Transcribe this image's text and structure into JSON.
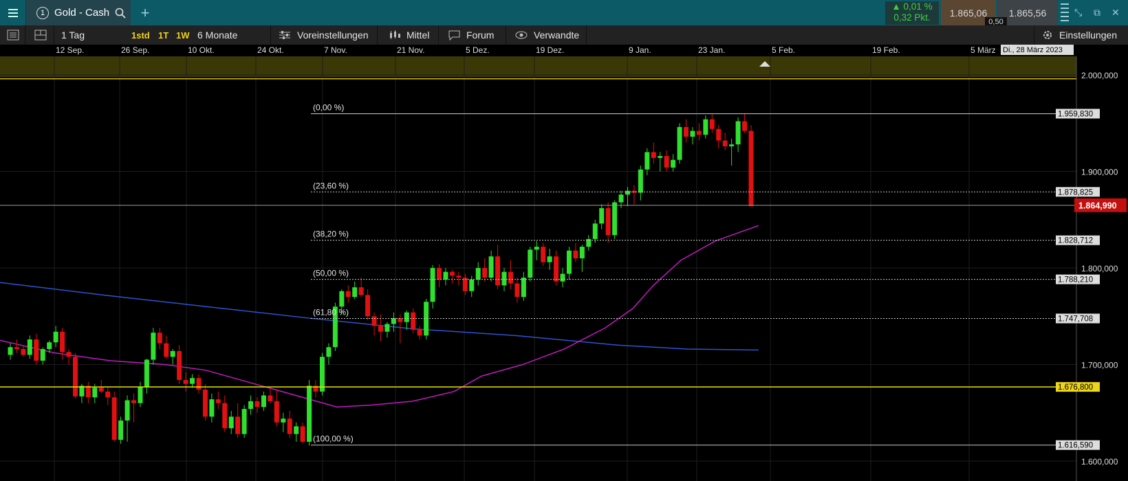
{
  "header": {
    "instrument_number": "1",
    "instrument_name": "Gold - Cash",
    "add_tab": "+",
    "change_percent": "0,01 %",
    "change_points": "0,32 Pkt.",
    "bid": "1.865,06",
    "ask": "1.865,56",
    "spread": "0,50",
    "change_color": "#3fd03f"
  },
  "toolbar": {
    "interval": "1 Tag",
    "quick1": "1std",
    "quick2": "1T",
    "quick3": "1W",
    "period": "6 Monate",
    "presets": "Voreinstellungen",
    "indicators": "Mittel",
    "forum": "Forum",
    "related": "Verwandte",
    "settings": "Einstellungen"
  },
  "chart_data": {
    "type": "candlestick",
    "x_axis_labels": [
      "12 Sep.",
      "26 Sep.",
      "10 Okt.",
      "24 Okt.",
      "7 Nov.",
      "21 Nov.",
      "5 Dez.",
      "19 Dez.",
      "9 Jan.",
      "23 Jan.",
      "5 Feb.",
      "19 Feb.",
      "5 März"
    ],
    "crosshair_date": "Di., 28 März 2023",
    "y_axis_labels": [
      "2.000,000",
      "1.900,000",
      "1.800,000",
      "1.700,000",
      "1.600,000"
    ],
    "ylim": [
      1582,
      2052
    ],
    "current_price": "1.864,990",
    "current_price_value": 1864.99,
    "fibonacci": [
      {
        "label": "(0,00 %)",
        "value": 1959.83,
        "tag": "1.959,830"
      },
      {
        "label": "(23,60 %)",
        "value": 1878.825,
        "tag": "1.878,825"
      },
      {
        "label": "(38,20 %)",
        "value": 1828.712,
        "tag": "1.828,712"
      },
      {
        "label": "(50,00 %)",
        "value": 1788.21,
        "tag": "1.788,210"
      },
      {
        "label": "(61,80 %)",
        "value": 1747.708,
        "tag": "1.747,708"
      },
      {
        "label": "(100,00 %)",
        "value": 1616.59,
        "tag": "1.616,590"
      }
    ],
    "horizontal_line": {
      "value": 1676.8,
      "tag": "1.676,800",
      "color": "#e6e600"
    },
    "upper_line": {
      "value": 1996,
      "color": "#e6c400"
    },
    "candles": [
      [
        1710,
        1722,
        1705,
        1718
      ],
      [
        1718,
        1726,
        1712,
        1716
      ],
      [
        1716,
        1720,
        1708,
        1710
      ],
      [
        1710,
        1730,
        1706,
        1726
      ],
      [
        1726,
        1732,
        1700,
        1704
      ],
      [
        1704,
        1718,
        1700,
        1716
      ],
      [
        1716,
        1725,
        1712,
        1723
      ],
      [
        1723,
        1740,
        1718,
        1734
      ],
      [
        1734,
        1738,
        1705,
        1713
      ],
      [
        1713,
        1716,
        1700,
        1708
      ],
      [
        1708,
        1712,
        1665,
        1667
      ],
      [
        1667,
        1680,
        1660,
        1678
      ],
      [
        1678,
        1682,
        1660,
        1666
      ],
      [
        1666,
        1680,
        1660,
        1676
      ],
      [
        1676,
        1684,
        1670,
        1672
      ],
      [
        1672,
        1676,
        1658,
        1666
      ],
      [
        1666,
        1672,
        1620,
        1622
      ],
      [
        1622,
        1646,
        1618,
        1642
      ],
      [
        1642,
        1668,
        1620,
        1663
      ],
      [
        1663,
        1670,
        1640,
        1660
      ],
      [
        1660,
        1682,
        1656,
        1677
      ],
      [
        1677,
        1706,
        1670,
        1705
      ],
      [
        1705,
        1738,
        1700,
        1733
      ],
      [
        1733,
        1738,
        1716,
        1722
      ],
      [
        1722,
        1730,
        1706,
        1708
      ],
      [
        1708,
        1716,
        1700,
        1714
      ],
      [
        1714,
        1720,
        1680,
        1684
      ],
      [
        1684,
        1692,
        1672,
        1680
      ],
      [
        1680,
        1690,
        1676,
        1686
      ],
      [
        1686,
        1690,
        1670,
        1674
      ],
      [
        1674,
        1680,
        1642,
        1646
      ],
      [
        1646,
        1670,
        1640,
        1664
      ],
      [
        1664,
        1672,
        1654,
        1660
      ],
      [
        1660,
        1668,
        1630,
        1634
      ],
      [
        1634,
        1652,
        1628,
        1646
      ],
      [
        1646,
        1660,
        1624,
        1628
      ],
      [
        1628,
        1658,
        1624,
        1654
      ],
      [
        1654,
        1668,
        1648,
        1662
      ],
      [
        1662,
        1666,
        1650,
        1656
      ],
      [
        1656,
        1672,
        1652,
        1668
      ],
      [
        1668,
        1676,
        1660,
        1662
      ],
      [
        1662,
        1674,
        1636,
        1640
      ],
      [
        1640,
        1650,
        1630,
        1644
      ],
      [
        1644,
        1652,
        1624,
        1628
      ],
      [
        1628,
        1640,
        1620,
        1636
      ],
      [
        1636,
        1640,
        1618,
        1620
      ],
      [
        1620,
        1684,
        1616,
        1678
      ],
      [
        1678,
        1684,
        1666,
        1672
      ],
      [
        1672,
        1712,
        1668,
        1708
      ],
      [
        1708,
        1722,
        1700,
        1718
      ],
      [
        1718,
        1764,
        1714,
        1760
      ],
      [
        1760,
        1778,
        1752,
        1776
      ],
      [
        1776,
        1782,
        1764,
        1770
      ],
      [
        1770,
        1786,
        1768,
        1780
      ],
      [
        1780,
        1790,
        1770,
        1772
      ],
      [
        1772,
        1778,
        1746,
        1750
      ],
      [
        1750,
        1754,
        1730,
        1740
      ],
      [
        1740,
        1752,
        1724,
        1734
      ],
      [
        1734,
        1744,
        1728,
        1742
      ],
      [
        1742,
        1754,
        1734,
        1748
      ],
      [
        1748,
        1752,
        1722,
        1744
      ],
      [
        1744,
        1756,
        1736,
        1754
      ],
      [
        1754,
        1758,
        1732,
        1736
      ],
      [
        1736,
        1740,
        1726,
        1730
      ],
      [
        1730,
        1768,
        1726,
        1765
      ],
      [
        1765,
        1803,
        1758,
        1800
      ],
      [
        1800,
        1804,
        1780,
        1788
      ],
      [
        1788,
        1800,
        1782,
        1796
      ],
      [
        1796,
        1798,
        1784,
        1792
      ],
      [
        1792,
        1796,
        1782,
        1790
      ],
      [
        1790,
        1794,
        1772,
        1776
      ],
      [
        1776,
        1792,
        1770,
        1788
      ],
      [
        1788,
        1806,
        1782,
        1800
      ],
      [
        1800,
        1810,
        1786,
        1790
      ],
      [
        1790,
        1818,
        1786,
        1812
      ],
      [
        1812,
        1824,
        1778,
        1782
      ],
      [
        1782,
        1800,
        1776,
        1796
      ],
      [
        1796,
        1808,
        1778,
        1784
      ],
      [
        1784,
        1790,
        1764,
        1770
      ],
      [
        1770,
        1796,
        1766,
        1790
      ],
      [
        1790,
        1822,
        1786,
        1819
      ],
      [
        1819,
        1828,
        1808,
        1822
      ],
      [
        1822,
        1826,
        1802,
        1806
      ],
      [
        1806,
        1820,
        1798,
        1812
      ],
      [
        1812,
        1818,
        1782,
        1786
      ],
      [
        1786,
        1800,
        1780,
        1794
      ],
      [
        1794,
        1822,
        1788,
        1818
      ],
      [
        1818,
        1826,
        1806,
        1810
      ],
      [
        1810,
        1824,
        1796,
        1822
      ],
      [
        1822,
        1834,
        1818,
        1830
      ],
      [
        1830,
        1850,
        1826,
        1846
      ],
      [
        1846,
        1866,
        1840,
        1862
      ],
      [
        1862,
        1868,
        1826,
        1834
      ],
      [
        1834,
        1870,
        1830,
        1868
      ],
      [
        1868,
        1880,
        1862,
        1876
      ],
      [
        1876,
        1884,
        1864,
        1880
      ],
      [
        1880,
        1886,
        1866,
        1878
      ],
      [
        1878,
        1906,
        1870,
        1902
      ],
      [
        1902,
        1924,
        1896,
        1920
      ],
      [
        1920,
        1930,
        1908,
        1914
      ],
      [
        1914,
        1920,
        1900,
        1916
      ],
      [
        1916,
        1922,
        1900,
        1904
      ],
      [
        1904,
        1918,
        1900,
        1912
      ],
      [
        1912,
        1950,
        1908,
        1946
      ],
      [
        1946,
        1954,
        1930,
        1936
      ],
      [
        1936,
        1946,
        1928,
        1942
      ],
      [
        1942,
        1950,
        1932,
        1938
      ],
      [
        1938,
        1958,
        1934,
        1954
      ],
      [
        1954,
        1960,
        1940,
        1944
      ],
      [
        1944,
        1948,
        1924,
        1932
      ],
      [
        1932,
        1940,
        1922,
        1926
      ],
      [
        1926,
        1934,
        1906,
        1928
      ],
      [
        1928,
        1956,
        1920,
        1952
      ],
      [
        1952,
        1960,
        1940,
        1942
      ],
      [
        1942,
        1948,
        1880,
        1864
      ]
    ]
  }
}
